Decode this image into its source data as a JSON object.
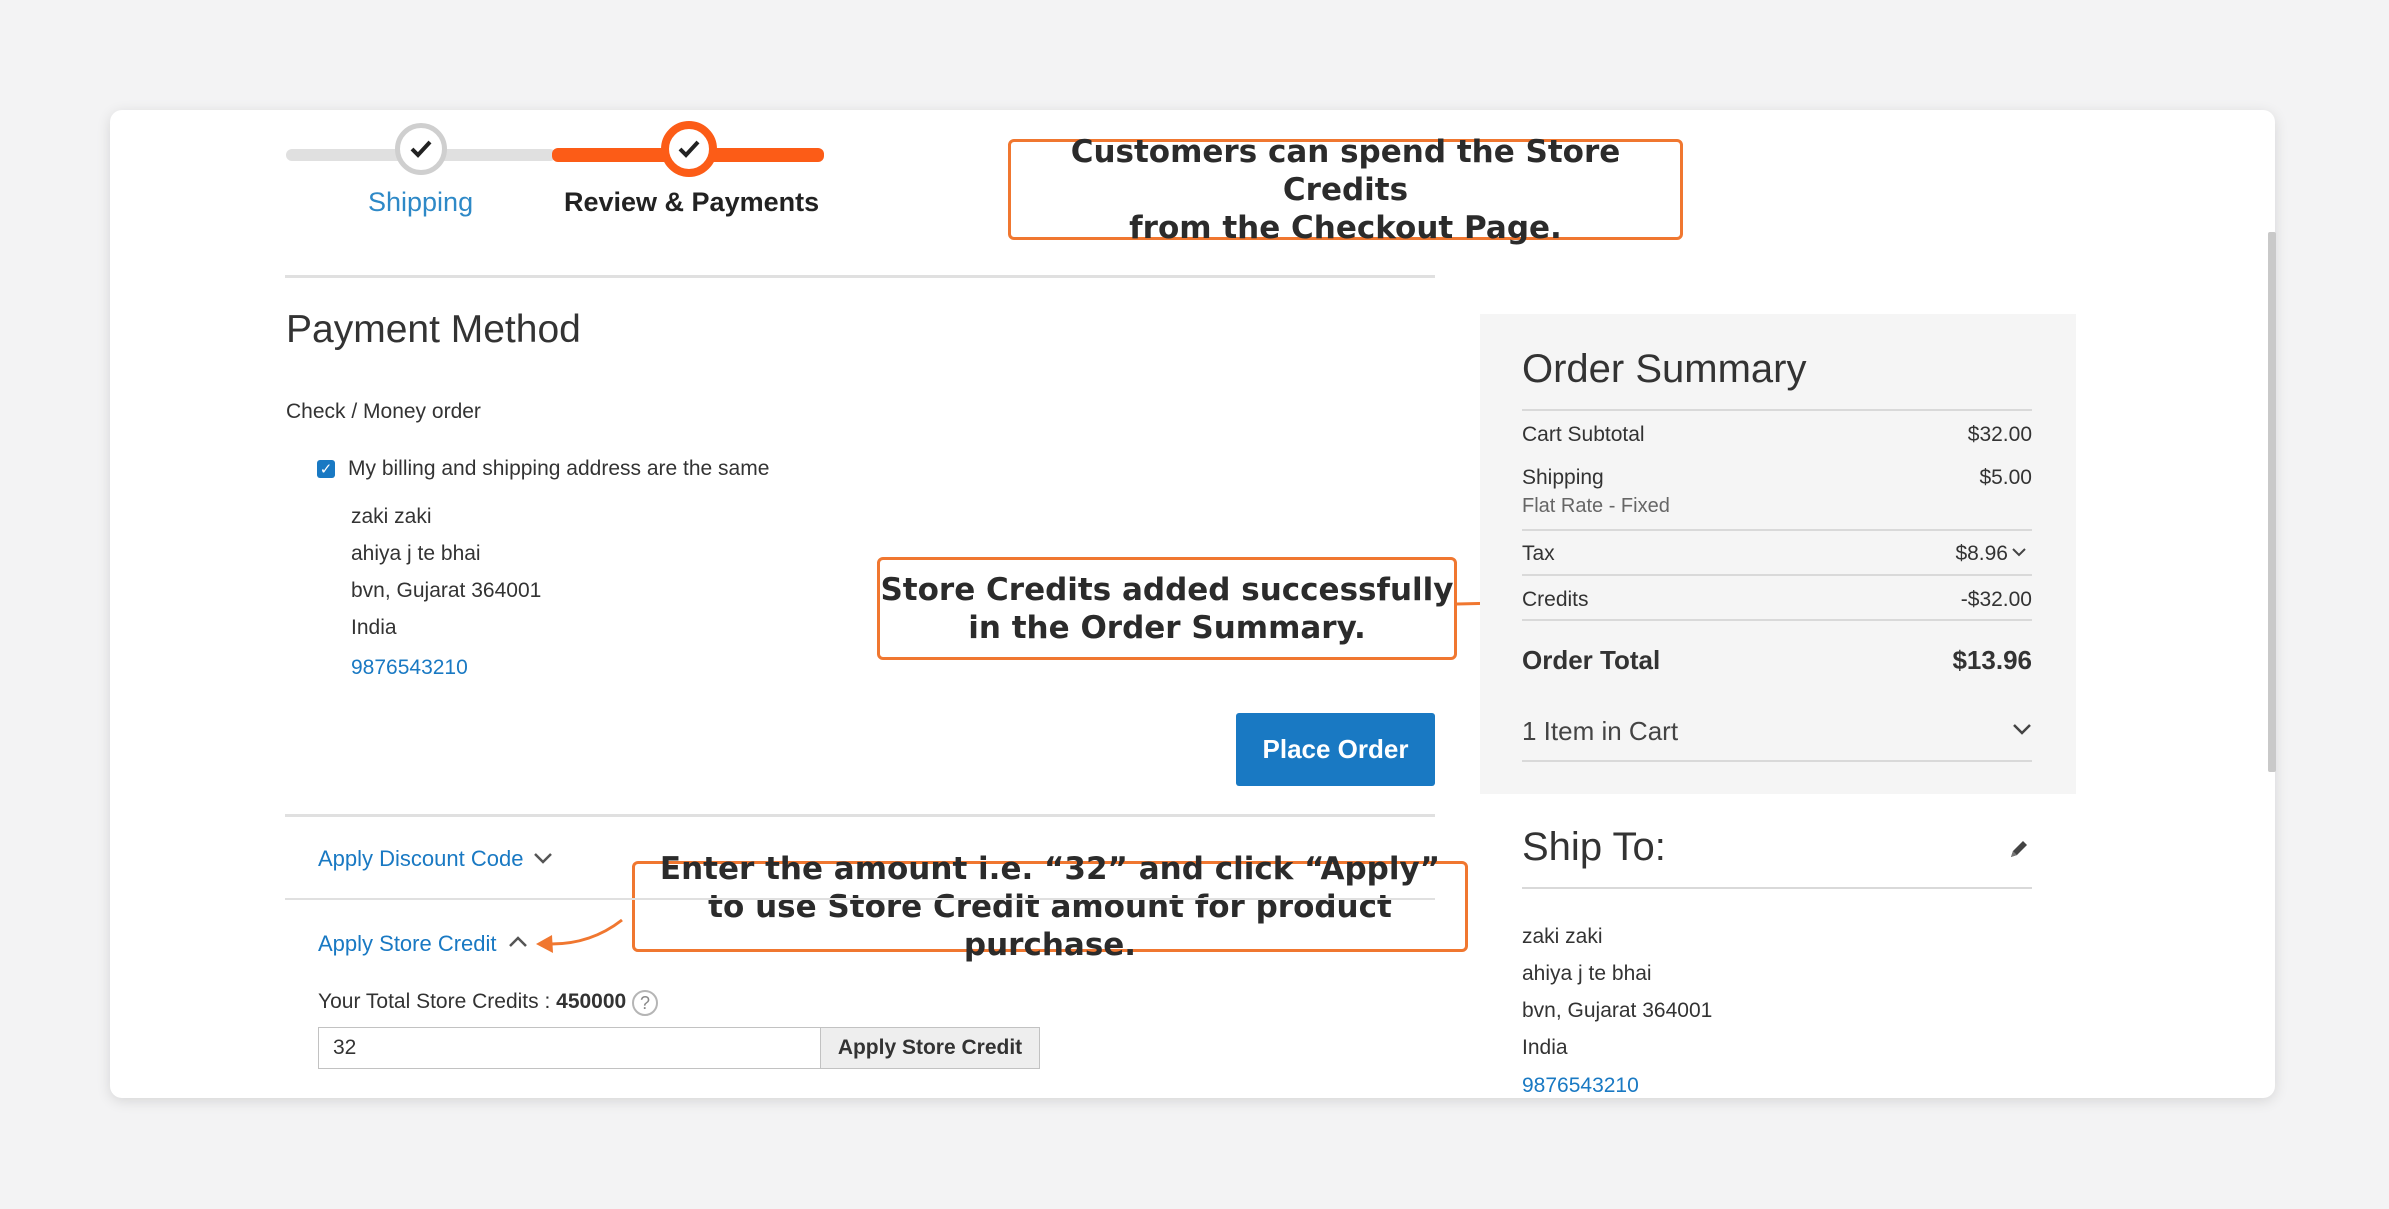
{
  "progress": {
    "steps": [
      {
        "label": "Shipping",
        "state": "complete"
      },
      {
        "label": "Review & Payments",
        "state": "active"
      }
    ],
    "check_icon": "checkmark-icon"
  },
  "callouts": {
    "top": [
      "Customers can spend the Store Credits",
      "from the Checkout Page."
    ],
    "middle": [
      "Store Credits added successfully",
      "in the Order Summary."
    ],
    "bottom": [
      "Enter the amount i.e. “32” and click “Apply”",
      "to use Store Credit amount for product purchase."
    ]
  },
  "payment": {
    "title": "Payment Method",
    "method": "Check / Money order",
    "same_address_label": "My billing and shipping address are the same",
    "address": {
      "name": "zaki zaki",
      "street": "ahiya j te bhai",
      "city": "bvn, Gujarat 364001",
      "country": "India",
      "phone": "9876543210"
    },
    "place_order_label": "Place Order"
  },
  "discount": {
    "label": "Apply Discount Code"
  },
  "store_credit": {
    "label": "Apply Store Credit",
    "total_label": "Your Total Store Credits : ",
    "total_value": "450000",
    "help": "?",
    "input_value": "32",
    "button_label": "Apply Store Credit"
  },
  "summary": {
    "title": "Order Summary",
    "rows": [
      {
        "label": "Cart Subtotal",
        "value": "$32.00"
      },
      {
        "label": "Shipping",
        "sub": "Flat Rate - Fixed",
        "value": "$5.00"
      },
      {
        "label": "Tax",
        "value": "$8.96"
      },
      {
        "label": "Credits",
        "value": "-$32.00"
      }
    ],
    "total_label": "Order Total",
    "total_value": "$13.96",
    "items_label": "1 Item in Cart"
  },
  "ship_to": {
    "title": "Ship To:",
    "name": "zaki zaki",
    "street": "ahiya j te bhai",
    "city": "bvn, Gujarat 364001",
    "country": "India",
    "phone": "9876543210"
  },
  "colors": {
    "accent_orange": "#fc5c17",
    "primary_blue": "#1979c3",
    "link_blue": "#2e89c7"
  }
}
